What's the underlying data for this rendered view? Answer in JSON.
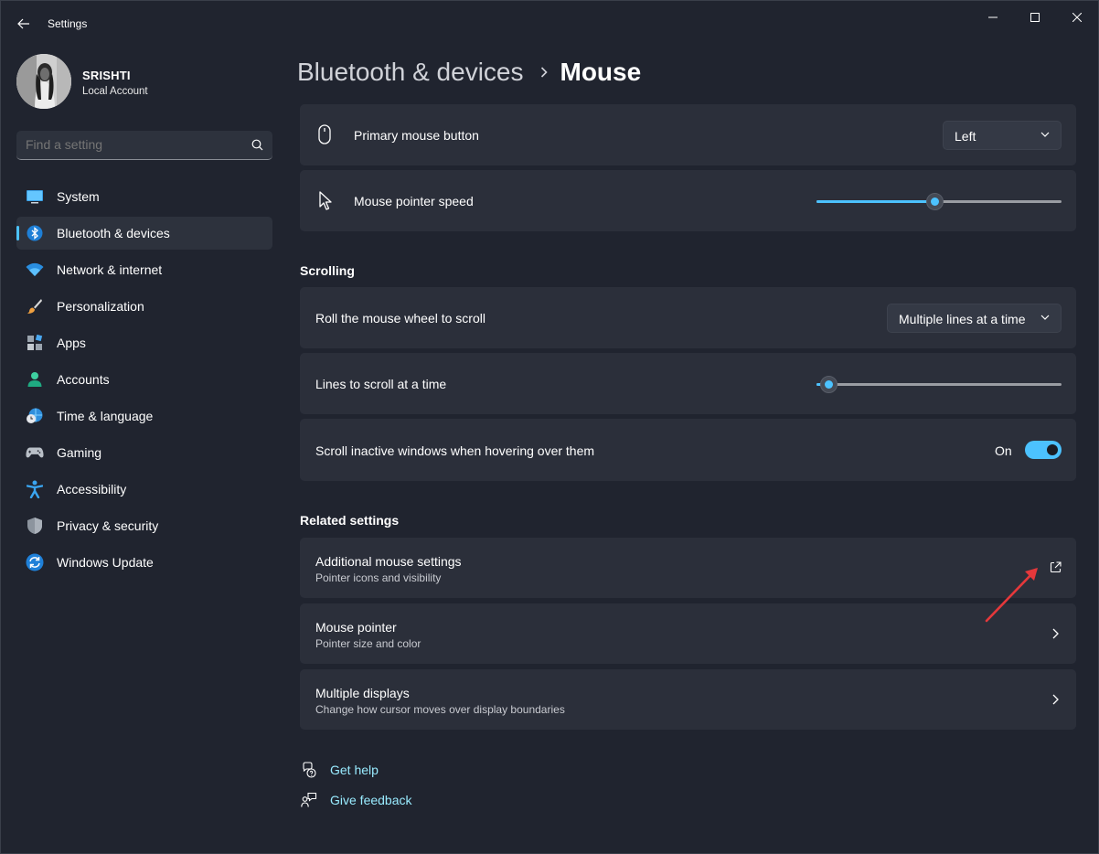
{
  "window": {
    "title": "Settings"
  },
  "user": {
    "name": "SRISHTI",
    "account_type": "Local Account"
  },
  "search": {
    "placeholder": "Find a setting"
  },
  "sidebar": {
    "items": [
      {
        "label": "System",
        "icon": "monitor-icon",
        "active": false
      },
      {
        "label": "Bluetooth & devices",
        "icon": "bluetooth-icon",
        "active": true
      },
      {
        "label": "Network & internet",
        "icon": "wifi-icon",
        "active": false
      },
      {
        "label": "Personalization",
        "icon": "brush-icon",
        "active": false
      },
      {
        "label": "Apps",
        "icon": "apps-icon",
        "active": false
      },
      {
        "label": "Accounts",
        "icon": "person-icon",
        "active": false
      },
      {
        "label": "Time & language",
        "icon": "globe-clock-icon",
        "active": false
      },
      {
        "label": "Gaming",
        "icon": "gamepad-icon",
        "active": false
      },
      {
        "label": "Accessibility",
        "icon": "accessibility-icon",
        "active": false
      },
      {
        "label": "Privacy & security",
        "icon": "shield-icon",
        "active": false
      },
      {
        "label": "Windows Update",
        "icon": "update-icon",
        "active": false
      }
    ]
  },
  "header": {
    "parent": "Bluetooth & devices",
    "current": "Mouse"
  },
  "mouse": {
    "primary_button": {
      "label": "Primary mouse button",
      "value": "Left"
    },
    "pointer_speed": {
      "label": "Mouse pointer speed",
      "level": 0.48
    }
  },
  "scrolling": {
    "title": "Scrolling",
    "wheel": {
      "label": "Roll the mouse wheel to scroll",
      "value": "Multiple lines at a time"
    },
    "lines": {
      "label": "Lines to scroll at a time",
      "level": 0.05
    },
    "inactive": {
      "label": "Scroll inactive windows when hovering over them",
      "state": "On"
    }
  },
  "related": {
    "title": "Related settings",
    "items": [
      {
        "title": "Additional mouse settings",
        "subtitle": "Pointer icons and visibility",
        "action": "external-link-icon"
      },
      {
        "title": "Mouse pointer",
        "subtitle": "Pointer size and color",
        "action": "chevron-right-icon"
      },
      {
        "title": "Multiple displays",
        "subtitle": "Change how cursor moves over display boundaries",
        "action": "chevron-right-icon"
      }
    ]
  },
  "footer": {
    "help": "Get help",
    "feedback": "Give feedback"
  },
  "colors": {
    "accent": "#4cc2ff",
    "background": "#20242f",
    "card": "#2b2f3a",
    "annotation_arrow": "#e5383b"
  }
}
